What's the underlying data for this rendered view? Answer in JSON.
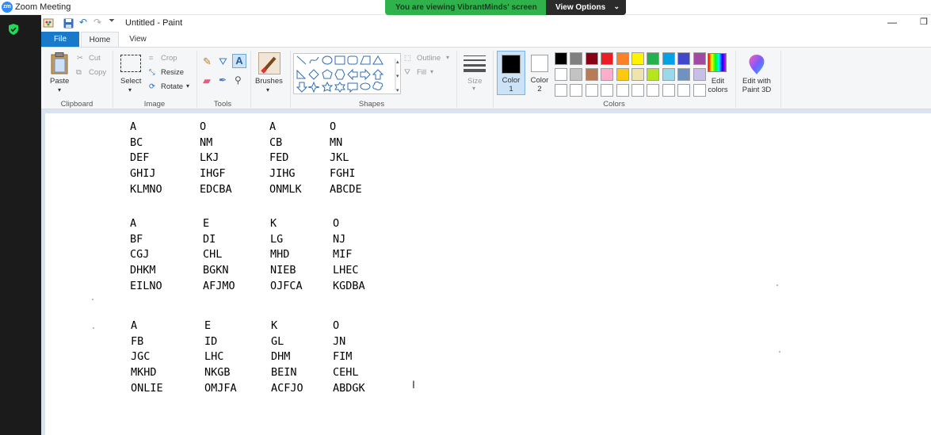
{
  "zoom": {
    "window_title": "Zoom Meeting",
    "logo_text": "zm",
    "banner_text": "You are viewing VibrantMinds' screen",
    "view_options_label": "View Options"
  },
  "paint": {
    "title": "Untitled - Paint",
    "tabs": [
      "File",
      "Home",
      "View"
    ],
    "clipboard": {
      "paste": "Paste",
      "cut": "Cut",
      "copy": "Copy",
      "group": "Clipboard"
    },
    "image": {
      "select": "Select",
      "crop": "Crop",
      "resize": "Resize",
      "rotate": "Rotate",
      "group": "Image"
    },
    "tools": {
      "group": "Tools"
    },
    "brushes": {
      "label": "Brushes"
    },
    "shapes": {
      "outline": "Outline",
      "fill": "Fill",
      "group": "Shapes"
    },
    "size": {
      "label": "Size"
    },
    "colors": {
      "color1": "Color 1",
      "color2": "Color 2",
      "edit": "Edit colors",
      "paint3d": "Edit with Paint 3D",
      "group": "Colors",
      "color1_value": "#000000",
      "color2_value": "#ffffff",
      "palette_row1": [
        "#000000",
        "#7f7f7f",
        "#880015",
        "#ed1c24",
        "#ff7f27",
        "#fff200",
        "#22b14c",
        "#00a2e8",
        "#3f48cc",
        "#a349a4"
      ],
      "palette_row2": [
        "#ffffff",
        "#c3c3c3",
        "#b97a57",
        "#ffaec9",
        "#ffc90e",
        "#efe4b0",
        "#b5e61d",
        "#99d9ea",
        "#7092be",
        "#c8bfe7"
      ],
      "palette_row3": [
        "#ffffff",
        "#ffffff",
        "#ffffff",
        "#ffffff",
        "#ffffff",
        "#ffffff",
        "#ffffff",
        "#ffffff",
        "#ffffff",
        "#ffffff"
      ]
    }
  },
  "canvas_text": {
    "block1": [
      [
        "A",
        "BC",
        "DEF",
        "GHIJ",
        "KLMNO"
      ],
      [
        "O",
        "NM",
        "LKJ",
        "IHGF",
        "EDCBA"
      ],
      [
        "A",
        "CB",
        "FED",
        "JIHG",
        "ONMLK"
      ],
      [
        "O",
        "MN",
        "JKL",
        "FGHI",
        "ABCDE"
      ]
    ],
    "block2": [
      [
        "A",
        "BF",
        "CGJ",
        "DHKM",
        "EILNO"
      ],
      [
        "E",
        "DI",
        "CHL",
        "BGKN",
        "AFJMO"
      ],
      [
        "K",
        "LG",
        "MHD",
        "NIEB",
        "OJFCA"
      ],
      [
        "O",
        "NJ",
        "MIF",
        "LHEC",
        "KGDBA"
      ]
    ],
    "block3": [
      [
        "A",
        "FB",
        "JGC",
        "MKHD",
        "ONLIE"
      ],
      [
        "E",
        "ID",
        "LHC",
        "NKGB",
        "OMJFA"
      ],
      [
        "K",
        "GL",
        "DHM",
        "BEIN",
        "ACFJO"
      ],
      [
        "O",
        "JN",
        "FIM",
        "CEHL",
        "ABDGK"
      ]
    ]
  }
}
